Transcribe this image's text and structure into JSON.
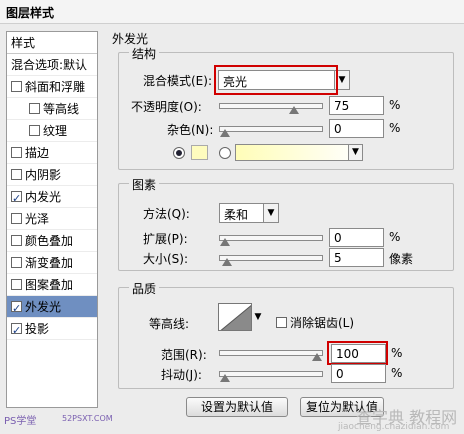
{
  "window": {
    "title": "图层样式"
  },
  "sidebar": {
    "header": "样式",
    "items": [
      {
        "label": "混合选项:默认",
        "checkbox": false,
        "checked": false,
        "indent": false,
        "selected": false
      },
      {
        "label": "斜面和浮雕",
        "checkbox": true,
        "checked": false,
        "indent": false,
        "selected": false
      },
      {
        "label": "等高线",
        "checkbox": true,
        "checked": false,
        "indent": true,
        "selected": false
      },
      {
        "label": "纹理",
        "checkbox": true,
        "checked": false,
        "indent": true,
        "selected": false
      },
      {
        "label": "描边",
        "checkbox": true,
        "checked": false,
        "indent": false,
        "selected": false
      },
      {
        "label": "内阴影",
        "checkbox": true,
        "checked": false,
        "indent": false,
        "selected": false
      },
      {
        "label": "内发光",
        "checkbox": true,
        "checked": true,
        "indent": false,
        "selected": false
      },
      {
        "label": "光泽",
        "checkbox": true,
        "checked": false,
        "indent": false,
        "selected": false
      },
      {
        "label": "颜色叠加",
        "checkbox": true,
        "checked": false,
        "indent": false,
        "selected": false
      },
      {
        "label": "渐变叠加",
        "checkbox": true,
        "checked": false,
        "indent": false,
        "selected": false
      },
      {
        "label": "图案叠加",
        "checkbox": true,
        "checked": false,
        "indent": false,
        "selected": false
      },
      {
        "label": "外发光",
        "checkbox": true,
        "checked": true,
        "indent": false,
        "selected": true
      },
      {
        "label": "投影",
        "checkbox": true,
        "checked": true,
        "indent": false,
        "selected": false
      }
    ]
  },
  "panel": {
    "title": "外发光",
    "structure": {
      "title": "结构",
      "blend_mode_label": "混合模式(E):",
      "blend_mode_value": "亮光",
      "opacity_label": "不透明度(O):",
      "opacity_value": "75",
      "opacity_unit": "%",
      "opacity_level": 75,
      "noise_label": "杂色(N):",
      "noise_value": "0",
      "noise_unit": "%",
      "noise_level": 0,
      "glow_color": "#fefcbe"
    },
    "elements": {
      "title": "图素",
      "method_label": "方法(Q):",
      "method_value": "柔和",
      "spread_label": "扩展(P):",
      "spread_value": "0",
      "spread_unit": "%",
      "spread_level": 0,
      "size_label": "大小(S):",
      "size_value": "5",
      "size_unit": "像素",
      "size_level": 2
    },
    "quality": {
      "title": "品质",
      "contour_label": "等高线:",
      "antialias_label": "消除锯齿(L)",
      "antialias_checked": false,
      "range_label": "范围(R):",
      "range_value": "100",
      "range_unit": "%",
      "range_level": 100,
      "jitter_label": "抖动(J):",
      "jitter_value": "0",
      "jitter_unit": "%",
      "jitter_level": 0
    },
    "buttons": {
      "set_default": "设置为默认值",
      "reset_default": "复位为默认值"
    }
  },
  "watermarks": {
    "left": "PS学堂",
    "left_url": "52PSXT.COM",
    "right": "查字典 教程网",
    "right_url": "jiaocheng.chazidian.com"
  },
  "colors": {
    "selection": "#6f8fc1",
    "highlight_border": "#d00000",
    "glow_swatch": "#fefcbe"
  }
}
